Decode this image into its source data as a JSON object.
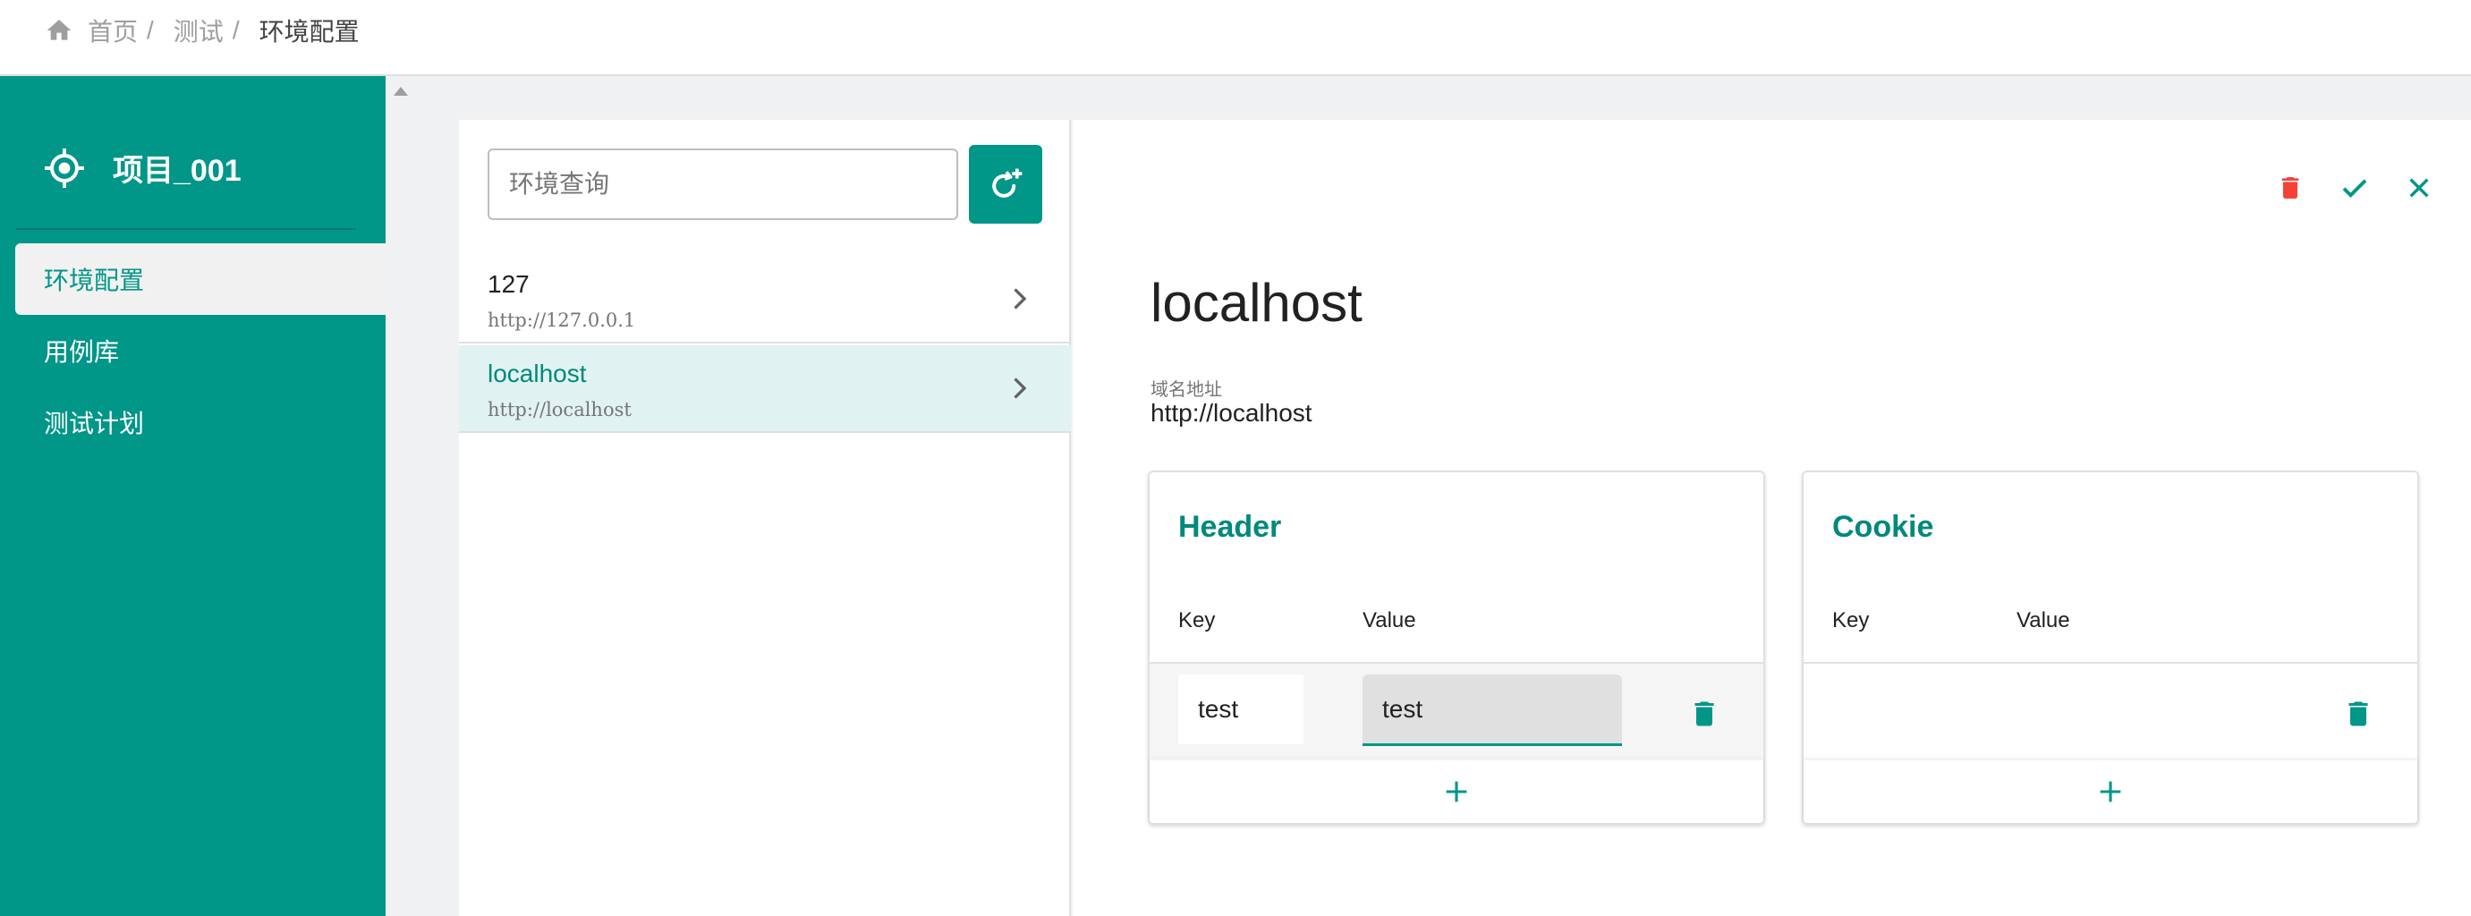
{
  "breadcrumb": {
    "items": [
      "首页",
      "测试",
      "环境配置"
    ],
    "separator": "/"
  },
  "sidebar": {
    "project_name": "项目_001",
    "items": [
      {
        "label": "环境配置",
        "active": true
      },
      {
        "label": "用例库",
        "active": false
      },
      {
        "label": "测试计划",
        "active": false
      }
    ]
  },
  "env_list": {
    "search_placeholder": "环境查询",
    "items": [
      {
        "name": "127",
        "url": "http://127.0.0.1",
        "selected": false
      },
      {
        "name": "localhost",
        "url": "http://localhost",
        "selected": true
      }
    ]
  },
  "detail": {
    "title": "localhost",
    "domain_label": "域名地址",
    "domain_value": "http://localhost",
    "header": {
      "title": "Header",
      "col_key": "Key",
      "col_value": "Value",
      "rows": [
        {
          "key": "test",
          "value": "test"
        }
      ]
    },
    "cookie": {
      "title": "Cookie",
      "col_key": "Key",
      "col_value": "Value"
    }
  },
  "colors": {
    "primary": "#009688",
    "danger": "#f44336",
    "background": "#f0f1f3"
  },
  "icons": {
    "breadcrumb": "home-icon",
    "project": "target-icon",
    "refresh": "refresh-plus-icon",
    "chevron": "chevron-right-icon",
    "delete": "trash-icon",
    "confirm": "check-icon",
    "close": "close-icon",
    "add": "plus-icon"
  }
}
